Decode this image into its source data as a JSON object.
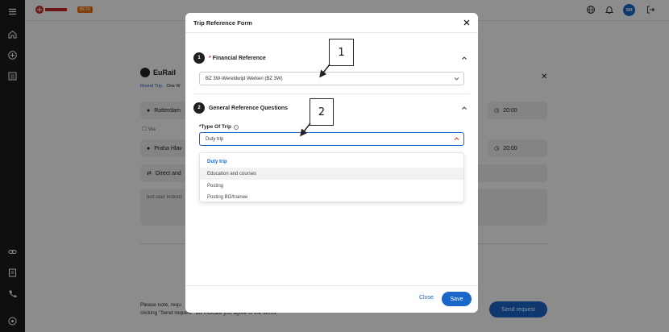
{
  "topbar": {
    "beta_badge": "BETA",
    "avatar_initials": "SM"
  },
  "background": {
    "title": "EuRail",
    "tab_round_trip": "Round Trip",
    "tab_one_way": "One W",
    "from_field": "Rotterdam",
    "via_label": "Via",
    "to_field": "Praha Hlav",
    "time_1": "20:00",
    "time_2": "20:00",
    "direct_label": "Direct and",
    "note_line1": "Please note, requ",
    "note_line2": "clicking \"Send request\" will indicate you agree to the terms.",
    "send_button": "Send request"
  },
  "modal": {
    "title": "Trip Reference Form",
    "section1": {
      "number": "1",
      "required_marker": "*",
      "title": "Financial Reference",
      "value": "BZ 3W-Wereldwijd Werken (BZ 3W)"
    },
    "section2": {
      "number": "2",
      "title": "General Reference Questions",
      "field_label": "*Type Of Trip",
      "value": "Duty trip"
    },
    "options": [
      "Duty trip",
      "Education and courses",
      "Posting",
      "Posting BO/trainee"
    ],
    "close_button": "Close",
    "save_button": "Save"
  },
  "callouts": {
    "one": "1",
    "two": "2"
  },
  "colors": {
    "accent": "#1a66c9",
    "sidebar": "#1c1c1c",
    "beta": "#e8761b"
  }
}
